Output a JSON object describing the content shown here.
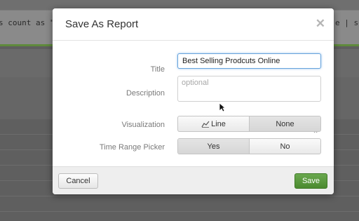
{
  "background": {
    "search_text_left": "s count as \"",
    "search_text_right": "e | so"
  },
  "modal": {
    "title": "Save As Report",
    "close_icon": "close-icon",
    "fields": {
      "title": {
        "label": "Title",
        "value": "Best Selling Prodcuts Online"
      },
      "description": {
        "label": "Description",
        "placeholder": "optional",
        "value": ""
      },
      "visualization": {
        "label": "Visualization",
        "options": [
          {
            "label": "Line",
            "icon": "line-chart-icon"
          },
          {
            "label": "None"
          }
        ],
        "selected": "None"
      },
      "time_range_picker": {
        "label": "Time Range Picker",
        "options": [
          {
            "label": "Yes"
          },
          {
            "label": "No"
          }
        ],
        "selected": "Yes"
      }
    },
    "footer": {
      "cancel_label": "Cancel",
      "save_label": "Save"
    }
  },
  "colors": {
    "save_button": "#5a9a3c",
    "input_focus_border": "#66a3dc",
    "search_bar_accent": "#5f8a3c"
  }
}
